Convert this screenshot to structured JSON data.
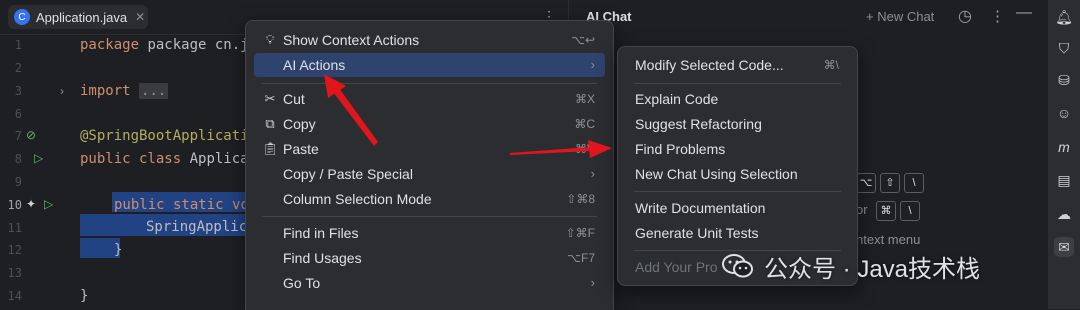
{
  "editor": {
    "tab_label": "Application.java",
    "tab_icon": "java-class-icon",
    "lines": [
      {
        "n": "1",
        "code": "package cn.javastack"
      },
      {
        "n": "2",
        "code": ""
      },
      {
        "n": "3",
        "code": "import ..."
      },
      {
        "n": "6",
        "code": ""
      },
      {
        "n": "7",
        "code": "@SpringBootApplicati"
      },
      {
        "n": "8",
        "code": "public class Applicat"
      },
      {
        "n": "9",
        "code": ""
      },
      {
        "n": "10",
        "code": "public static vo"
      },
      {
        "n": "11",
        "code": "SpringApplica"
      },
      {
        "n": "12",
        "code": "}"
      },
      {
        "n": "13",
        "code": ""
      },
      {
        "n": "14",
        "code": "}"
      }
    ]
  },
  "context_menu": {
    "items": [
      {
        "label": "Show Context Actions",
        "shortcut": "⌥↩",
        "icon": "lightbulb-icon"
      },
      {
        "label": "AI Actions",
        "arrow": "›",
        "highlighted": true
      },
      {
        "label": "Cut",
        "shortcut": "⌘X",
        "icon": "scissors-icon"
      },
      {
        "label": "Copy",
        "shortcut": "⌘C",
        "icon": "copy-icon"
      },
      {
        "label": "Paste",
        "shortcut": "⌘V",
        "icon": "paste-icon"
      },
      {
        "label": "Copy / Paste Special",
        "arrow": "›"
      },
      {
        "label": "Column Selection Mode",
        "shortcut": "⇧⌘8"
      },
      {
        "label": "Find in Files",
        "shortcut": "⇧⌘F"
      },
      {
        "label": "Find Usages",
        "shortcut": "⌥F7"
      },
      {
        "label": "Go To",
        "arrow": "›"
      }
    ]
  },
  "ai_submenu": {
    "items": [
      {
        "label": "Modify Selected Code...",
        "shortcut": "⌘\\"
      },
      {
        "label": "Explain Code"
      },
      {
        "label": "Suggest Refactoring"
      },
      {
        "label": "Find Problems"
      },
      {
        "label": "New Chat Using Selection"
      },
      {
        "label": "Write Documentation"
      },
      {
        "label": "Generate Unit Tests"
      },
      {
        "label": "Add Your Pro",
        "disabled": true
      }
    ]
  },
  "chat_panel": {
    "title": "AI Chat",
    "new_chat": "+ New Chat",
    "shortcut1_keys": [
      "⌥",
      "⇧",
      "\\"
    ],
    "shortcut2_or": "or",
    "shortcut2_keys": [
      "⌘",
      "\\"
    ],
    "context_hint": "ntext menu"
  },
  "watermark": {
    "text": "公众号 · Java技术栈"
  },
  "colors": {
    "highlight": "#2e436e",
    "selection": "#214283",
    "arrow": "#e0161c"
  }
}
